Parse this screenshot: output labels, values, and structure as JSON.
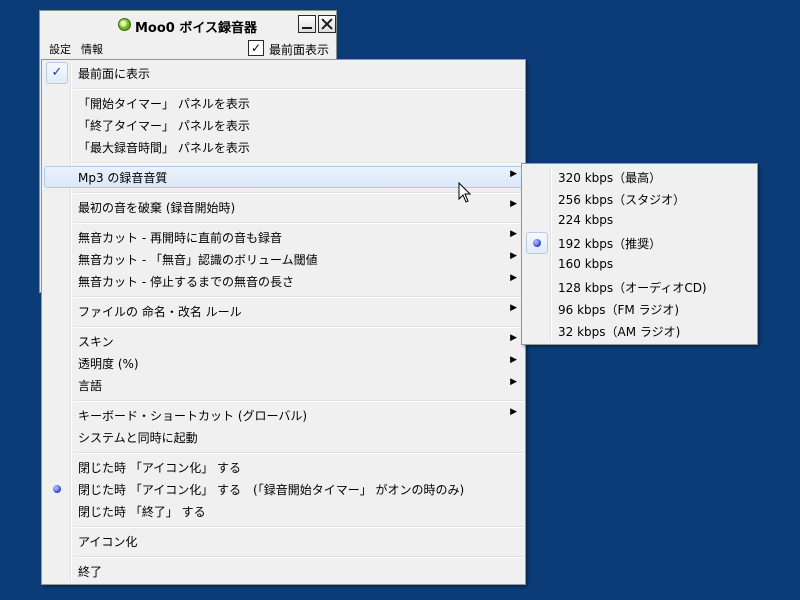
{
  "app": {
    "title": "Moo0 ボイス録音器",
    "menu_bar": [
      "設定",
      "情報"
    ],
    "topmost_label": "最前面表示",
    "topmost_checked": true
  },
  "context_menu": {
    "items": [
      {
        "label": "最前面に表示",
        "check": true
      },
      {
        "label": "「開始タイマー」 パネルを表示"
      },
      {
        "label": "「終了タイマー」 パネルを表示"
      },
      {
        "label": "「最大録音時間」 パネルを表示"
      },
      {
        "label": "Mp3 の録音音質",
        "submenu": true,
        "highlighted": true
      },
      {
        "label": "最初の音を破棄 (録音開始時)",
        "submenu": true
      },
      {
        "label": "無音カット - 再開時に直前の音も録音",
        "submenu": true
      },
      {
        "label": "無音カット - 「無音」認識のボリューム閾値",
        "submenu": true
      },
      {
        "label": "無音カット - 停止するまでの無音の長さ",
        "submenu": true
      },
      {
        "label": "ファイルの 命名・改名 ルール",
        "submenu": true
      },
      {
        "label": "スキン",
        "submenu": true
      },
      {
        "label": "透明度 (%)",
        "submenu": true
      },
      {
        "label": "言語",
        "submenu": true
      },
      {
        "label": "キーボード・ショートカット (グローバル)",
        "submenu": true
      },
      {
        "label": "システムと同時に起動"
      },
      {
        "label": "閉じた時 「アイコン化」 する"
      },
      {
        "label": "閉じた時 「アイコン化」 する　(「録音開始タイマー」 がオンの時のみ)",
        "radio": true
      },
      {
        "label": "閉じた時 「終了」 する"
      },
      {
        "label": "アイコン化"
      },
      {
        "label": "終了"
      }
    ]
  },
  "quality_submenu": {
    "items": [
      {
        "label": "320 kbps（最高）"
      },
      {
        "label": "256 kbps（スタジオ）"
      },
      {
        "label": "224 kbps"
      },
      {
        "label": "192 kbps（推奨）",
        "selected": true
      },
      {
        "label": "160 kbps"
      },
      {
        "label": "128 kbps（オーディオCD)"
      },
      {
        "label": "96 kbps（FM ラジオ)"
      },
      {
        "label": "32 kbps（AM ラジオ)"
      }
    ]
  },
  "icons": {
    "check": "✓",
    "submenu_arrow": "▶"
  },
  "colors": {
    "desktop": "#0c3c78",
    "menu_bg": "#f0f0f0",
    "highlight_border": "#aecbee"
  }
}
